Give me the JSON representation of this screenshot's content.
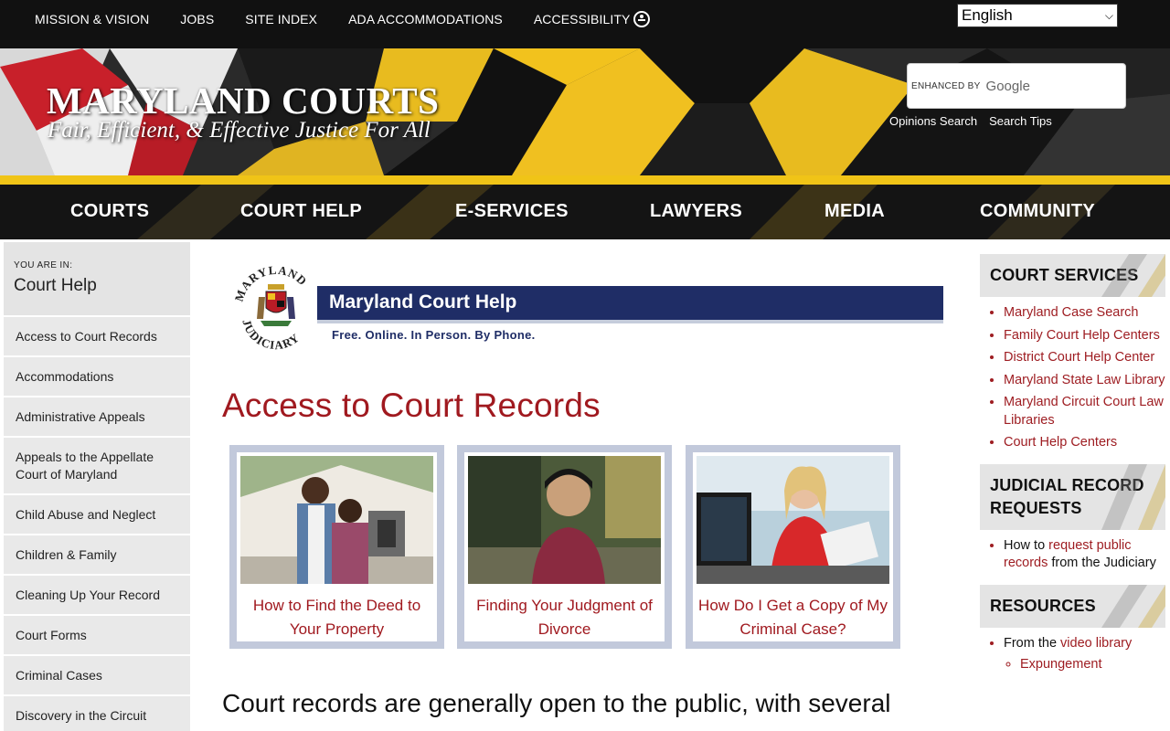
{
  "topbar": {
    "links": [
      "MISSION & VISION",
      "JOBS",
      "SITE INDEX",
      "ADA ACCOMMODATIONS",
      "ACCESSIBILITY"
    ],
    "language": "English"
  },
  "header": {
    "title": "MARYLAND COURTS",
    "tagline": "Fair, Efficient, & Effective Justice For All",
    "search_enhanced": "ENHANCED BY",
    "search_google": "Google",
    "search_links": [
      "Opinions Search",
      "Search Tips"
    ]
  },
  "nav": [
    "COURTS",
    "COURT HELP",
    "E-SERVICES",
    "LAWYERS",
    "MEDIA",
    "COMMUNITY"
  ],
  "sidebar": {
    "you_are_in": "YOU ARE IN:",
    "current": "Court Help",
    "items": [
      "Access to Court Records",
      "Accommodations",
      "Administrative Appeals",
      "Appeals to the Appellate Court of Maryland",
      "Child Abuse and Neglect",
      "Children & Family",
      "Cleaning Up Your Record",
      "Court Forms",
      "Criminal Cases",
      "Discovery in the Circuit"
    ]
  },
  "logo": {
    "seal_top": "MARYLAND",
    "seal_bottom": "JUDICIARY",
    "banner": "Maryland Court Help",
    "sub": "Free. Online. In Person. By Phone."
  },
  "main": {
    "heading": "Access to Court Records",
    "cards": [
      {
        "caption": "How to Find the Deed to Your Property"
      },
      {
        "caption": "Finding Your Judgment of Divorce"
      },
      {
        "caption": "How Do I Get a Copy of My Criminal Case?"
      }
    ],
    "intro": "Court records are generally open to the public, with several"
  },
  "right": {
    "court_services": {
      "title": "COURT SERVICES",
      "links": [
        "Maryland Case Search",
        "Family Court Help Centers",
        "District Court Help Center",
        "Maryland State Law Library",
        "Maryland Circuit Court Law Libraries",
        "Court Help Centers"
      ]
    },
    "judicial": {
      "title": "JUDICIAL RECORD REQUESTS",
      "pre": "How to ",
      "link": "request public records",
      "post": " from the Judiciary"
    },
    "resources": {
      "title": "RESOURCES",
      "pre": "From the ",
      "link": "video library",
      "sub": "Expungement"
    }
  },
  "colors": {
    "accent_red": "#a0191f",
    "gold": "#f0c417",
    "navy": "#1f2d66"
  }
}
